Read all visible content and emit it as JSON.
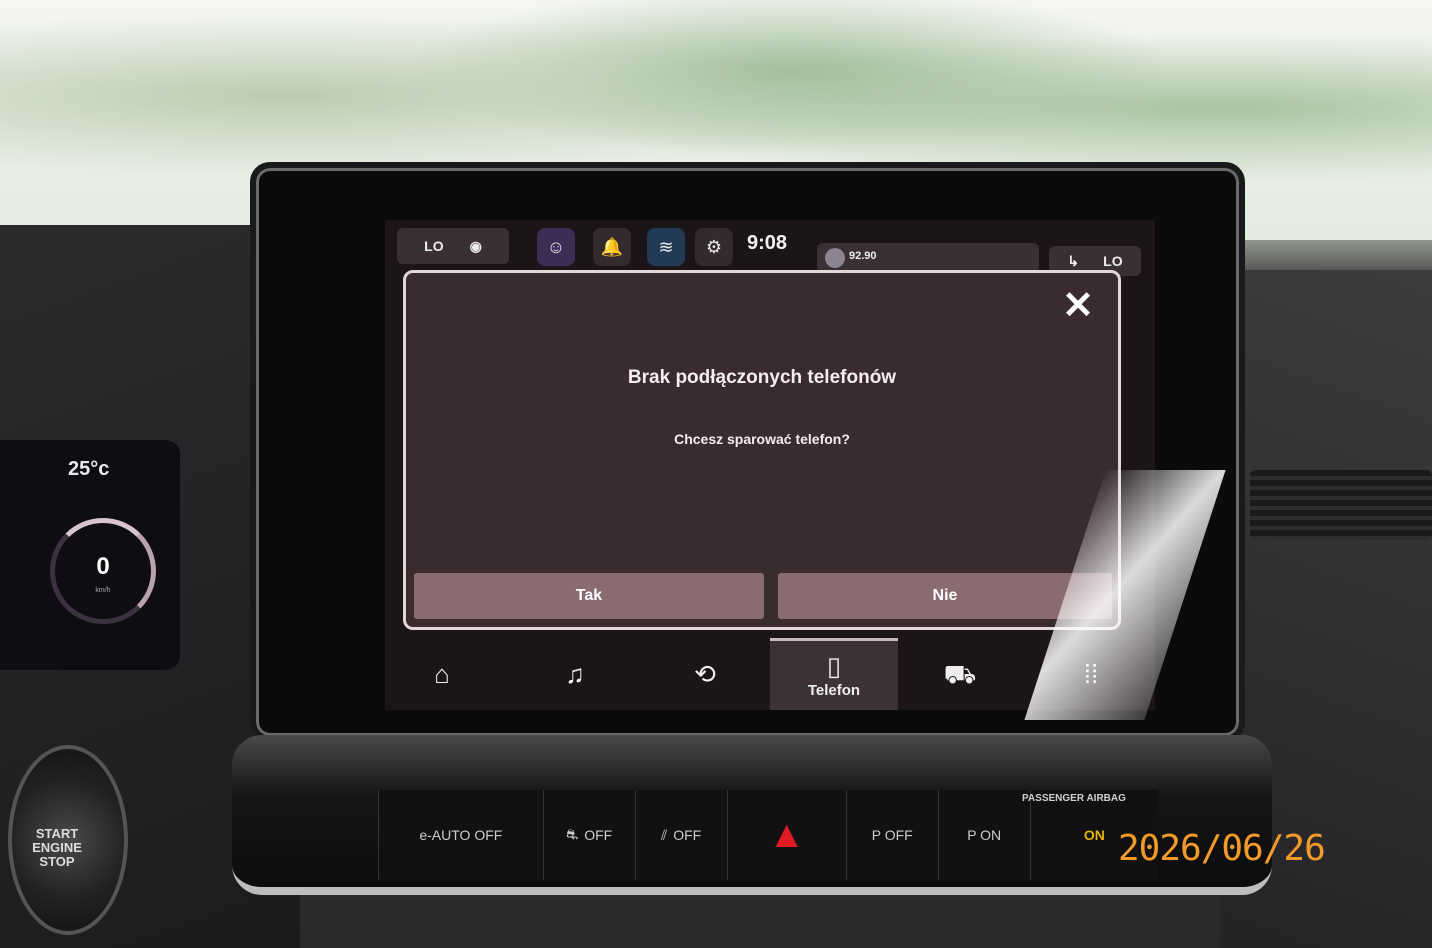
{
  "status_bar": {
    "left_temp": "LO",
    "right_temp": "LO",
    "time": "9:08",
    "radio_frequency": "92.90"
  },
  "dialog": {
    "title": "Brak podłączonych telefonów",
    "subtitle": "Chcesz sparować telefon?",
    "yes_label": "Tak",
    "no_label": "Nie",
    "close_glyph": "✕"
  },
  "nav": {
    "items": [
      {
        "name": "home",
        "glyph": "⌂"
      },
      {
        "name": "media",
        "glyph": "♫"
      },
      {
        "name": "apps",
        "glyph": "⟲"
      },
      {
        "name": "phone",
        "glyph": "▯",
        "label": "Telefon"
      },
      {
        "name": "vehicle",
        "glyph": "⛟"
      },
      {
        "name": "more",
        "glyph": "⁞⁞"
      }
    ]
  },
  "cluster": {
    "temperature": "25°c",
    "speed": "0",
    "speed_unit": "km/h"
  },
  "start_button": {
    "label": "START ENGINE STOP"
  },
  "controls": {
    "eauto": "e-AUTO OFF",
    "traction": "OFF",
    "lane": "OFF",
    "hazard": "▲",
    "park_sensor": "P OFF",
    "park_assist": "P ON",
    "airbag": "ON",
    "passenger_airbag_label": "PASSENGER AIRBAG"
  },
  "timestamp": "2026/06/26"
}
